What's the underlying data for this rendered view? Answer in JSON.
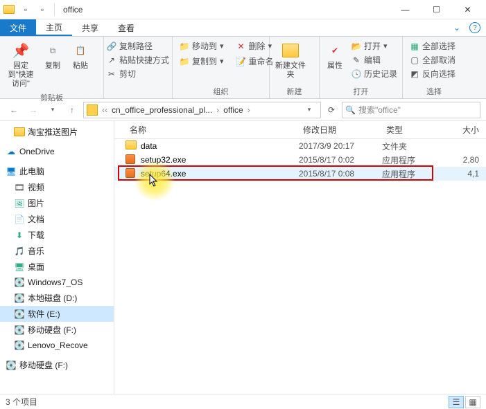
{
  "window": {
    "title": "office"
  },
  "tabs": {
    "file": "文件",
    "home": "主页",
    "share": "共享",
    "view": "查看"
  },
  "ribbon": {
    "pin": {
      "label": "固定到\"快速访问\""
    },
    "copy": "复制",
    "paste": "粘贴",
    "copy_path": "复制路径",
    "paste_shortcut": "粘贴快捷方式",
    "cut": "剪切",
    "group_clipboard": "剪贴板",
    "move_to": "移动到",
    "copy_to": "复制到",
    "delete": "删除",
    "rename": "重命名",
    "group_organize": "组织",
    "new_folder": "新建文件夹",
    "group_new": "新建",
    "properties": "属性",
    "open": "打开",
    "edit": "编辑",
    "history": "历史记录",
    "group_open": "打开",
    "select_all": "全部选择",
    "select_none": "全部取消",
    "invert_selection": "反向选择",
    "group_select": "选择"
  },
  "breadcrumb": {
    "seg1": "cn_office_professional_pl...",
    "seg2": "office"
  },
  "search": {
    "placeholder": "搜索\"office\""
  },
  "columns": {
    "name": "名称",
    "date": "修改日期",
    "type": "类型",
    "size": "大小"
  },
  "files": [
    {
      "name": "data",
      "date": "2017/3/9 20:17",
      "type": "文件夹",
      "size": "",
      "icon": "folder"
    },
    {
      "name": "setup32.exe",
      "date": "2015/8/17 0:02",
      "type": "应用程序",
      "size": "2,80",
      "icon": "exe"
    },
    {
      "name": "setup64.exe",
      "date": "2015/8/17 0:08",
      "type": "应用程序",
      "size": "4,1",
      "icon": "exe"
    }
  ],
  "nav": {
    "taobao": "淘宝推送图片",
    "onedrive": "OneDrive",
    "this_pc": "此电脑",
    "videos": "视频",
    "pictures": "图片",
    "documents": "文档",
    "downloads": "下载",
    "music": "音乐",
    "desktop": "桌面",
    "win7_os": "Windows7_OS",
    "local_d": "本地磁盘 (D:)",
    "soft_e": "软件 (E:)",
    "mobile_f": "移动硬盘 (F:)",
    "lenovo": "Lenovo_Recove",
    "mobile_f2": "移动硬盘 (F:)"
  },
  "status": {
    "count": "3 个项目"
  }
}
